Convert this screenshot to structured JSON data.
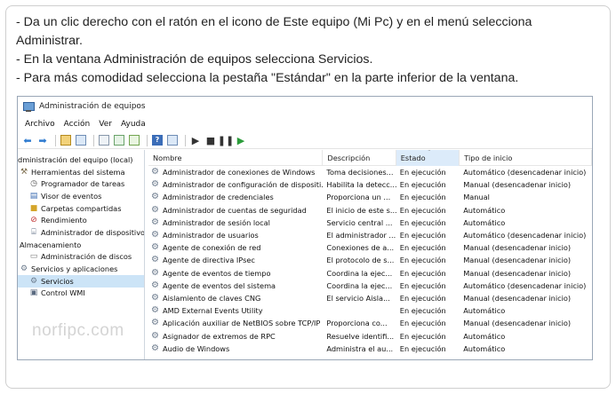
{
  "instructions": [
    "- Da un clic derecho con el ratón en el icono de Este equipo (Mi Pc) y en el menú selecciona",
    "Administrar.",
    "- En la ventana Administración de equipos selecciona Servicios.",
    "- Para más comodidad selecciona la pestaña \"Estándar\" en la parte inferior de la ventana."
  ],
  "window": {
    "title": "Administración de equipos",
    "menu": [
      "Archivo",
      "Acción",
      "Ver",
      "Ayuda"
    ]
  },
  "tree": [
    {
      "label": "dministración del equipo (local)",
      "icon": "computer-icon"
    },
    {
      "label": "Herramientas del sistema",
      "icon": "tools-icon"
    },
    {
      "label": "Programador de tareas",
      "icon": "clock-icon"
    },
    {
      "label": "Visor de eventos",
      "icon": "event-viewer-icon"
    },
    {
      "label": "Carpetas compartidas",
      "icon": "shared-folder-icon"
    },
    {
      "label": "Rendimiento",
      "icon": "performance-icon"
    },
    {
      "label": "Administrador de dispositivo",
      "icon": "device-manager-icon"
    },
    {
      "label": "Almacenamiento",
      "icon": "storage-icon"
    },
    {
      "label": "Administración de discos",
      "icon": "disk-icon"
    },
    {
      "label": "Servicios y aplicaciones",
      "icon": "services-apps-icon"
    },
    {
      "label": "Servicios",
      "icon": "services-icon"
    },
    {
      "label": "Control WMI",
      "icon": "wmi-icon"
    }
  ],
  "columns": {
    "name": "Nombre",
    "description": "Descripción",
    "state": "Estado",
    "startup": "Tipo de inicio"
  },
  "services": [
    {
      "name": "Administrador de conexiones de Windows",
      "description": "Toma decisiones...",
      "state": "En ejecución",
      "startup": "Automático (desencadenar inicio)"
    },
    {
      "name": "Administrador de configuración de dispositi...",
      "description": "Habilita la detecc...",
      "state": "En ejecución",
      "startup": "Manual (desencadenar inicio)"
    },
    {
      "name": "Administrador de credenciales",
      "description": "Proporciona un ...",
      "state": "En ejecución",
      "startup": "Manual"
    },
    {
      "name": "Administrador de cuentas de seguridad",
      "description": "El inicio de este s...",
      "state": "En ejecución",
      "startup": "Automático"
    },
    {
      "name": "Administrador de sesión local",
      "description": "Servicio central ...",
      "state": "En ejecución",
      "startup": "Automático"
    },
    {
      "name": "Administrador de usuarios",
      "description": "El administrador ...",
      "state": "En ejecución",
      "startup": "Automático (desencadenar inicio)"
    },
    {
      "name": "Agente de conexión de red",
      "description": "Conexiones de a...",
      "state": "En ejecución",
      "startup": "Manual (desencadenar inicio)"
    },
    {
      "name": "Agente de directiva IPsec",
      "description": "El protocolo de s...",
      "state": "En ejecución",
      "startup": "Manual (desencadenar inicio)"
    },
    {
      "name": "Agente de eventos de tiempo",
      "description": "Coordina la ejec...",
      "state": "En ejecución",
      "startup": "Manual (desencadenar inicio)"
    },
    {
      "name": "Agente de eventos del sistema",
      "description": "Coordina la ejec...",
      "state": "En ejecución",
      "startup": "Automático (desencadenar inicio)"
    },
    {
      "name": "Aislamiento de claves CNG",
      "description": "El servicio Aisla...",
      "state": "En ejecución",
      "startup": "Manual (desencadenar inicio)"
    },
    {
      "name": "AMD External Events Utility",
      "description": "",
      "state": "En ejecución",
      "startup": "Automático"
    },
    {
      "name": "Aplicación auxiliar de NetBIOS sobre TCP/IP",
      "description": "Proporciona co...",
      "state": "En ejecución",
      "startup": "Manual (desencadenar inicio)"
    },
    {
      "name": "Asignador de extremos de RPC",
      "description": "Resuelve identifi...",
      "state": "En ejecución",
      "startup": "Automático"
    },
    {
      "name": "Audio de Windows",
      "description": "Administra el au...",
      "state": "En ejecución",
      "startup": "Automático"
    }
  ],
  "watermark": "norfipc.com"
}
